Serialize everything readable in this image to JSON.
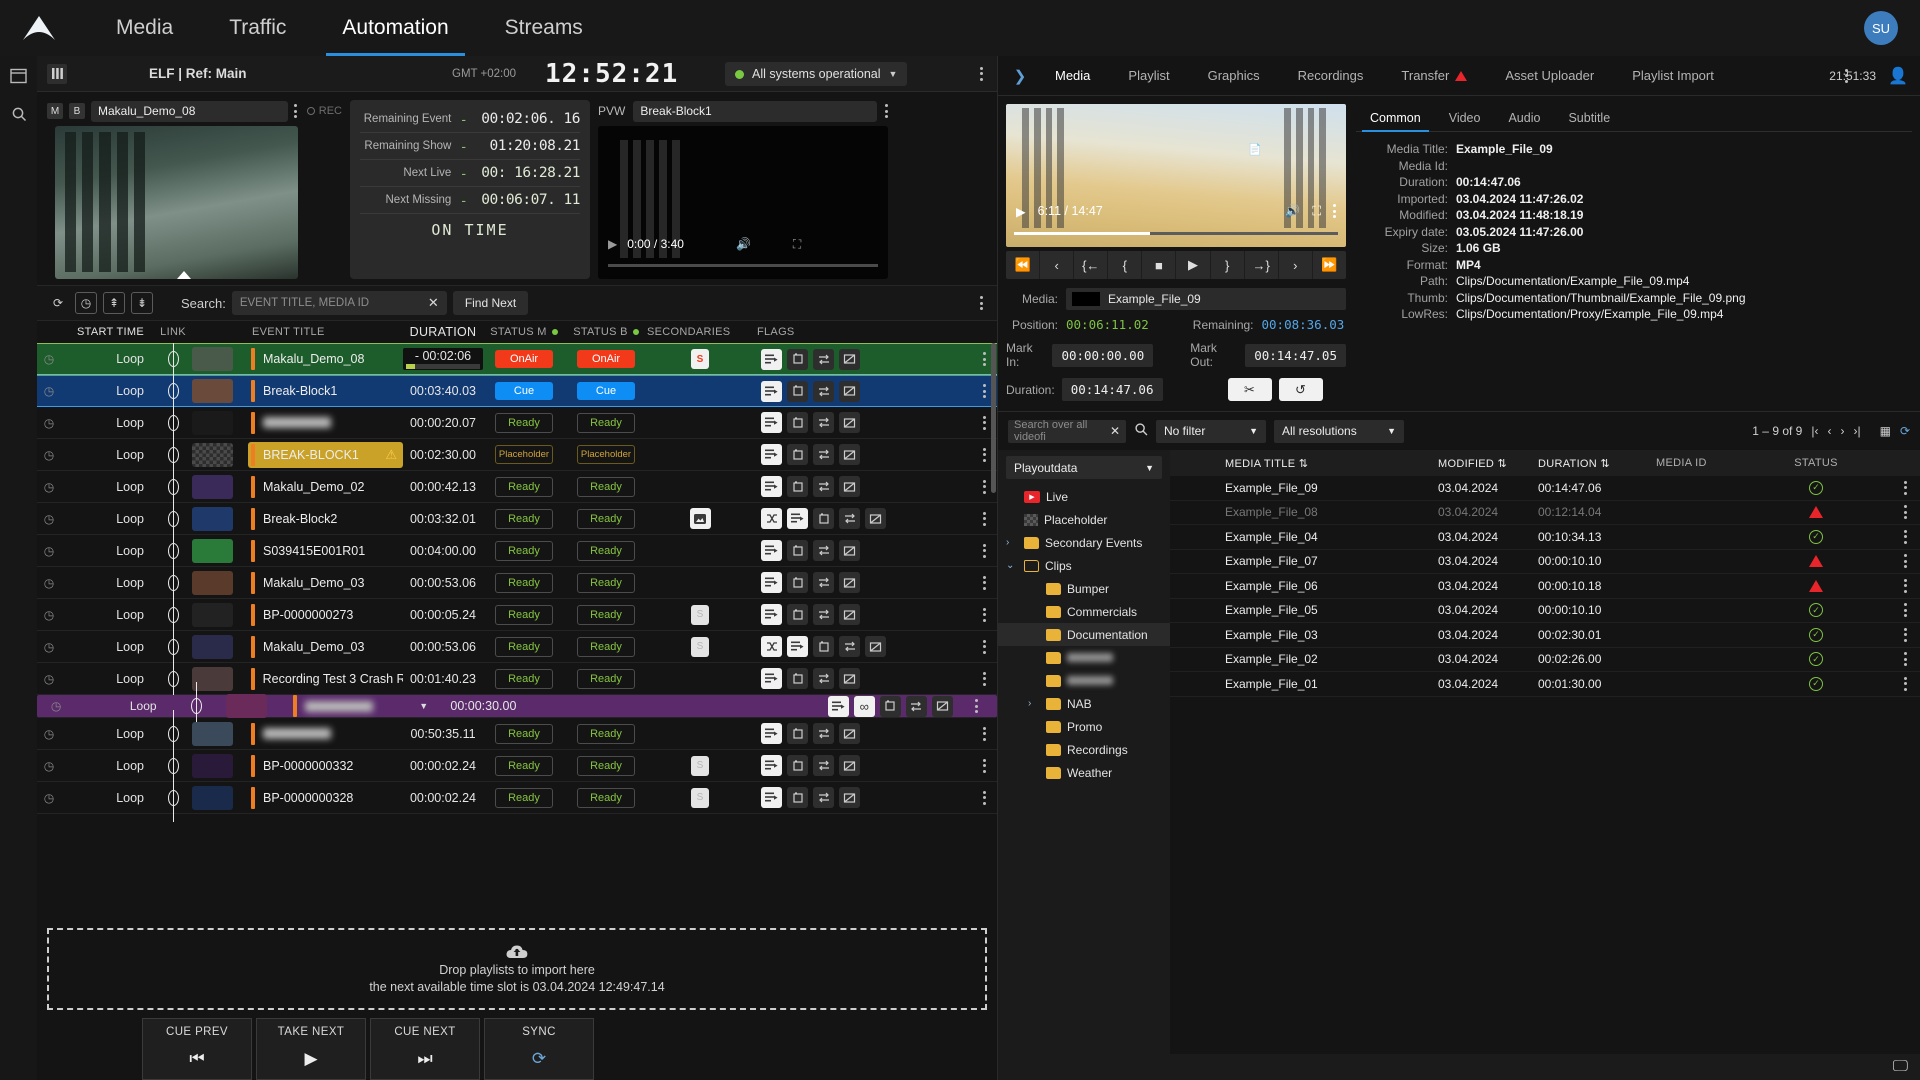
{
  "nav": {
    "tabs": [
      {
        "label": "Media",
        "active": false
      },
      {
        "label": "Traffic",
        "active": false
      },
      {
        "label": "Automation",
        "active": true
      },
      {
        "label": "Streams",
        "active": false
      }
    ],
    "avatar": "SU"
  },
  "playout_bar": {
    "grid_icon": "grid-icon",
    "ref_title": "ELF | Ref: Main",
    "gmt": "GMT +02:00",
    "clock": "12:52:21",
    "system_status": "All systems operational",
    "status_color": "#7ac943"
  },
  "program": {
    "m_badge": "M",
    "b_badge": "B",
    "name": "Makalu_Demo_08",
    "rec_label": "REC"
  },
  "timers": {
    "rows": [
      {
        "label": "Remaining Event",
        "sign": "-",
        "value": "00:02:06. 16"
      },
      {
        "label": "Remaining Show",
        "sign": "-",
        "value": "01:20:08.21"
      },
      {
        "label": "Next Live",
        "sign": "-",
        "value": "00: 16:28.21"
      },
      {
        "label": "Next Missing",
        "sign": "-",
        "value": "00:06:07. 11"
      }
    ],
    "status": "ON TIME"
  },
  "preview": {
    "label": "PVW",
    "name": "Break-Block1",
    "time": "0:00 / 3:40"
  },
  "search": {
    "label": "Search:",
    "placeholder": "EVENT TITLE, MEDIA ID",
    "clear": "✕",
    "find_next": "Find Next",
    "buttons": [
      "refresh-icon",
      "timer-icon",
      "jump-top-icon",
      "jump-bottom-icon"
    ]
  },
  "rundown": {
    "columns": [
      "START TIME",
      "LINK",
      "EVENT TITLE",
      "DURATION",
      "STATUS M",
      "STATUS B",
      "SECONDARIES",
      "FLAGS"
    ],
    "rows": [
      {
        "start": "Loop",
        "title": "Makalu_Demo_08",
        "blur": false,
        "duration": "- 00:02:06",
        "progress": true,
        "status_m": "OnAir",
        "status_b": "OnAir",
        "state": "onair",
        "secondaries": [
          "S"
        ],
        "flags": [
          "list",
          "repeat",
          "swap",
          "nomute"
        ],
        "shuffle": false,
        "loopinf": false,
        "img": false,
        "warn": false
      },
      {
        "start": "Loop",
        "title": "Break-Block1",
        "blur": false,
        "duration": "00:03:40.03",
        "status_m": "Cue",
        "status_b": "Cue",
        "state": "cue",
        "secondaries": [],
        "flags": [
          "list",
          "repeat",
          "swap",
          "nomute"
        ],
        "shuffle": false,
        "loopinf": false,
        "img": false,
        "warn": false
      },
      {
        "start": "Loop",
        "title": "Hidden_Title_01",
        "blur": true,
        "duration": "00:00:20.07",
        "status_m": "Ready",
        "status_b": "Ready",
        "state": "ready",
        "secondaries": [],
        "flags": [
          "list",
          "repeat",
          "swap",
          "nomute"
        ],
        "shuffle": false,
        "loopinf": false,
        "img": false,
        "warn": false
      },
      {
        "start": "Loop",
        "title": "BREAK-BLOCK1",
        "blur": false,
        "duration": "00:02:30.00",
        "status_m": "Placeholder",
        "status_b": "Placeholder",
        "state": "placeholder",
        "secondaries": [],
        "flags": [
          "list",
          "repeat",
          "swap",
          "nomute"
        ],
        "shuffle": false,
        "loopinf": false,
        "img": false,
        "warn": true
      },
      {
        "start": "Loop",
        "title": "Makalu_Demo_02",
        "blur": false,
        "duration": "00:00:42.13",
        "status_m": "Ready",
        "status_b": "Ready",
        "state": "ready",
        "secondaries": [],
        "flags": [
          "list",
          "repeat",
          "swap",
          "nomute"
        ],
        "shuffle": false,
        "loopinf": false,
        "img": false,
        "warn": false
      },
      {
        "start": "Loop",
        "title": "Break-Block2",
        "blur": false,
        "duration": "00:03:32.01",
        "status_m": "Ready",
        "status_b": "Ready",
        "state": "ready",
        "secondaries": [
          "image"
        ],
        "flags": [
          "list",
          "repeat",
          "swap",
          "nomute"
        ],
        "shuffle": true,
        "loopinf": false,
        "img": true,
        "warn": false
      },
      {
        "start": "Loop",
        "title": "S039415E001R01",
        "blur": false,
        "duration": "00:04:00.00",
        "status_m": "Ready",
        "status_b": "Ready",
        "state": "ready",
        "secondaries": [],
        "flags": [
          "list",
          "repeat",
          "swap",
          "nomute"
        ],
        "shuffle": false,
        "loopinf": false,
        "img": false,
        "warn": false
      },
      {
        "start": "Loop",
        "title": "Makalu_Demo_03",
        "blur": false,
        "duration": "00:00:53.06",
        "status_m": "Ready",
        "status_b": "Ready",
        "state": "ready",
        "secondaries": [],
        "flags": [
          "list",
          "repeat",
          "swap",
          "nomute"
        ],
        "shuffle": false,
        "loopinf": false,
        "img": false,
        "warn": false
      },
      {
        "start": "Loop",
        "title": "BP-0000000273",
        "blur": false,
        "duration": "00:00:05.24",
        "status_m": "Ready",
        "status_b": "Ready",
        "state": "ready",
        "secondaries": [
          "S"
        ],
        "flags": [
          "list",
          "repeat",
          "swap",
          "nomute"
        ],
        "shuffle": false,
        "loopinf": false,
        "img": false,
        "warn": false
      },
      {
        "start": "Loop",
        "title": "Makalu_Demo_03",
        "blur": false,
        "duration": "00:00:53.06",
        "status_m": "Ready",
        "status_b": "Ready",
        "state": "ready",
        "secondaries": [
          "S"
        ],
        "flags": [
          "list",
          "repeat",
          "swap",
          "nomute"
        ],
        "shuffle": true,
        "loopinf": false,
        "img": false,
        "warn": false
      },
      {
        "start": "Loop",
        "title": "Recording Test 3 Crash R...",
        "blur": false,
        "duration": "00:01:40.23",
        "status_m": "Ready",
        "status_b": "Ready",
        "state": "ready",
        "secondaries": [],
        "flags": [
          "list",
          "repeat",
          "swap",
          "nomute"
        ],
        "shuffle": false,
        "loopinf": false,
        "img": false,
        "warn": false
      },
      {
        "start": "Loop",
        "title": "Selected_Row_Hidden",
        "blur": true,
        "duration": "00:00:30.00",
        "status_m": "",
        "status_b": "",
        "state": "selected",
        "secondaries": [],
        "flags": [
          "list",
          "infinity",
          "repeat",
          "swap",
          "nomute"
        ],
        "shuffle": false,
        "loopinf": true,
        "img": false,
        "warn": false
      },
      {
        "start": "Loop",
        "title": "Hidden_Title_02",
        "blur": true,
        "duration": "00:50:35.11",
        "status_m": "Ready",
        "status_b": "Ready",
        "state": "ready",
        "secondaries": [],
        "flags": [
          "list",
          "repeat",
          "swap",
          "nomute"
        ],
        "shuffle": false,
        "loopinf": false,
        "img": false,
        "warn": false
      },
      {
        "start": "Loop",
        "title": "BP-0000000332",
        "blur": false,
        "duration": "00:00:02.24",
        "status_m": "Ready",
        "status_b": "Ready",
        "state": "ready",
        "secondaries": [
          "S"
        ],
        "flags": [
          "list",
          "repeat",
          "swap",
          "nomute"
        ],
        "shuffle": false,
        "loopinf": false,
        "img": false,
        "warn": false
      },
      {
        "start": "Loop",
        "title": "BP-0000000328",
        "blur": false,
        "duration": "00:00:02.24",
        "status_m": "Ready",
        "status_b": "Ready",
        "state": "ready",
        "secondaries": [
          "S"
        ],
        "flags": [
          "list",
          "repeat",
          "swap",
          "nomute"
        ],
        "shuffle": false,
        "loopinf": false,
        "img": false,
        "warn": false
      }
    ]
  },
  "dropzone": {
    "line1": "Drop playlists to import here",
    "line2": "the next available time slot is 03.04.2024 12:49:47.14",
    "icon": "upload-cloud-icon"
  },
  "transport": {
    "buttons": [
      {
        "label": "CUE PREV",
        "icon": "⏮"
      },
      {
        "label": "TAKE NEXT",
        "icon": "▶"
      },
      {
        "label": "CUE NEXT",
        "icon": "⏭"
      },
      {
        "label": "SYNC",
        "icon": "⟳"
      }
    ]
  },
  "right_panel": {
    "tabs": [
      {
        "label": "Media",
        "active": true,
        "warn": false
      },
      {
        "label": "Playlist",
        "active": false,
        "warn": false
      },
      {
        "label": "Graphics",
        "active": false,
        "warn": false
      },
      {
        "label": "Recordings",
        "active": false,
        "warn": false
      },
      {
        "label": "Transfer",
        "active": false,
        "warn": true
      },
      {
        "label": "Asset Uploader",
        "active": false,
        "warn": false
      },
      {
        "label": "Playlist Import",
        "active": false,
        "warn": false
      }
    ],
    "time": "21:51:33"
  },
  "player": {
    "time": "6:11 / 14:47",
    "transport_icons": [
      "⏪",
      "‹",
      "{←",
      "{",
      "■",
      "▶",
      "}",
      "→}",
      "›",
      "⏩"
    ],
    "media_label": "Media:",
    "media_value": "Example_File_09",
    "position_label": "Position:",
    "position_value": "00:06:11.02",
    "remaining_label": "Remaining:",
    "remaining_value": "00:08:36.03",
    "mark_in_label": "Mark In:",
    "mark_in": "00:00:00.00",
    "mark_out_label": "Mark Out:",
    "mark_out": "00:14:47.05",
    "duration_label": "Duration:",
    "duration": "00:14:47.06",
    "cut_icon": "scissors-icon",
    "reset_icon": "reset-icon"
  },
  "metadata": {
    "tabs": [
      {
        "label": "Common",
        "active": true
      },
      {
        "label": "Video",
        "active": false
      },
      {
        "label": "Audio",
        "active": false
      },
      {
        "label": "Subtitle",
        "active": false
      }
    ],
    "fields": [
      {
        "key": "Media Title:",
        "value": "Example_File_09",
        "icon": true
      },
      {
        "key": "Media Id:",
        "value": "",
        "icon": false
      },
      {
        "key": "Duration:",
        "value": "00:14:47.06",
        "icon": false
      },
      {
        "key": "Imported:",
        "value": "03.04.2024 11:47:26.02",
        "icon": false
      },
      {
        "key": "Modified:",
        "value": "03.04.2024 11:48:18.19",
        "icon": false
      },
      {
        "key": "Expiry date:",
        "value": "03.05.2024 11:47:26.00",
        "icon": false
      },
      {
        "key": "Size:",
        "value": "1.06 GB",
        "icon": false
      },
      {
        "key": "Format:",
        "value": "MP4",
        "icon": false
      },
      {
        "key": "Path:",
        "value": "Clips/Documentation/Example_File_09.mp4",
        "icon": false
      },
      {
        "key": "Thumb:",
        "value": "Clips/Documentation/Thumbnail/Example_File_09.png",
        "icon": false
      },
      {
        "key": "LowRes:",
        "value": "Clips/Documentation/Proxy/Example_File_09.mp4",
        "icon": false
      }
    ]
  },
  "media_browser": {
    "search_placeholder": "Search over all videofi",
    "filter": "No filter",
    "resolution": "All resolutions",
    "pager": "1 – 9 of 9",
    "root": "Playoutdata",
    "tree": [
      {
        "label": "Live",
        "icon": "live-icon",
        "depth": 0,
        "chev": "",
        "active": false,
        "blur": false
      },
      {
        "label": "Placeholder",
        "icon": "placeholder-icon",
        "depth": 0,
        "chev": "",
        "active": false,
        "blur": false
      },
      {
        "label": "Secondary Events",
        "icon": "folder-icon",
        "depth": 0,
        "chev": "›",
        "active": false,
        "blur": false
      },
      {
        "label": "Clips",
        "icon": "folder-open-icon",
        "depth": 0,
        "chev": "⌄",
        "active": false,
        "blur": false
      },
      {
        "label": "Bumper",
        "icon": "folder-icon",
        "depth": 1,
        "chev": "",
        "active": false,
        "blur": false
      },
      {
        "label": "Commercials",
        "icon": "folder-icon",
        "depth": 1,
        "chev": "",
        "active": false,
        "blur": false
      },
      {
        "label": "Documentation",
        "icon": "folder-icon",
        "depth": 1,
        "chev": "",
        "active": true,
        "blur": false
      },
      {
        "label": "Hidden_A",
        "icon": "folder-icon",
        "depth": 1,
        "chev": "",
        "active": false,
        "blur": true
      },
      {
        "label": "Hidden_B",
        "icon": "folder-icon",
        "depth": 1,
        "chev": "",
        "active": false,
        "blur": true
      },
      {
        "label": "NAB",
        "icon": "folder-icon",
        "depth": 1,
        "chev": "›",
        "active": false,
        "blur": false
      },
      {
        "label": "Promo",
        "icon": "folder-icon",
        "depth": 1,
        "chev": "",
        "active": false,
        "blur": false
      },
      {
        "label": "Recordings",
        "icon": "folder-icon",
        "depth": 1,
        "chev": "",
        "active": false,
        "blur": false
      },
      {
        "label": "Weather",
        "icon": "folder-icon",
        "depth": 1,
        "chev": "",
        "active": false,
        "blur": false
      }
    ],
    "columns": [
      "MEDIA TITLE",
      "MODIFIED",
      "DURATION",
      "MEDIA ID",
      "STATUS"
    ],
    "rows": [
      {
        "title": "Example_File_09",
        "modified": "03.04.2024",
        "duration": "00:14:47.06",
        "media_id": "",
        "status": "ok",
        "dim": false,
        "thumb": "#0a0a0a"
      },
      {
        "title": "Example_File_08",
        "modified": "03.04.2024",
        "duration": "00:12:14.04",
        "media_id": "",
        "status": "warn",
        "dim": true,
        "thumb": "#0a0a0a"
      },
      {
        "title": "Example_File_04",
        "modified": "03.04.2024",
        "duration": "00:10:34.13",
        "media_id": "",
        "status": "ok",
        "dim": false,
        "thumb": "#f2f2f2"
      },
      {
        "title": "Example_File_07",
        "modified": "03.04.2024",
        "duration": "00:00:10.10",
        "media_id": "",
        "status": "warn",
        "dim": false,
        "thumb": "#2b2b2b"
      },
      {
        "title": "Example_File_06",
        "modified": "03.04.2024",
        "duration": "00:00:10.18",
        "media_id": "",
        "status": "warn",
        "dim": false,
        "thumb": "#2d1440"
      },
      {
        "title": "Example_File_05",
        "modified": "03.04.2024",
        "duration": "00:00:10.10",
        "media_id": "",
        "status": "ok",
        "dim": false,
        "thumb": "#3a1a18"
      },
      {
        "title": "Example_File_03",
        "modified": "03.04.2024",
        "duration": "00:02:30.01",
        "media_id": "",
        "status": "ok",
        "dim": false,
        "thumb": "#1d2a3a"
      },
      {
        "title": "Example_File_02",
        "modified": "03.04.2024",
        "duration": "00:02:26.00",
        "media_id": "",
        "status": "ok",
        "dim": false,
        "thumb": "#0a0a0a"
      },
      {
        "title": "Example_File_01",
        "modified": "03.04.2024",
        "duration": "00:01:30.00",
        "media_id": "",
        "status": "ok",
        "dim": false,
        "thumb": "#0a0a0a"
      }
    ]
  },
  "colors": {
    "accent": "#2b8fe0",
    "onair": "#f23a1b",
    "cue": "#0e8ef5",
    "ready": "#84c341",
    "placeholder": "#cfa53a",
    "orange": "#ef7d22"
  }
}
